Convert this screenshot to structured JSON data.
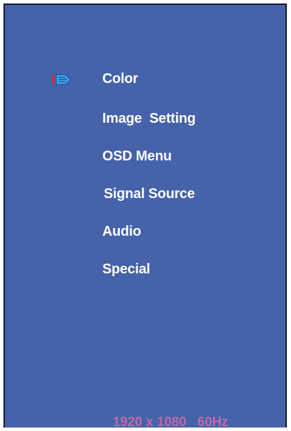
{
  "osd": {
    "menu_items": [
      {
        "label": "Color",
        "selected": true
      },
      {
        "label": "Image  Setting"
      },
      {
        "label": "OSD Menu"
      },
      {
        "label": "Signal Source"
      },
      {
        "label": "Audio"
      },
      {
        "label": "Special"
      }
    ],
    "status": "1920 x 1080   60Hz",
    "selector_icon": "pointer-arrow-icon"
  },
  "colors": {
    "background": "#4562aa",
    "text": "#ffffff",
    "status_text": "#c06aa8",
    "selector_red": "#e0283a",
    "selector_blue": "#3aa8e8"
  }
}
